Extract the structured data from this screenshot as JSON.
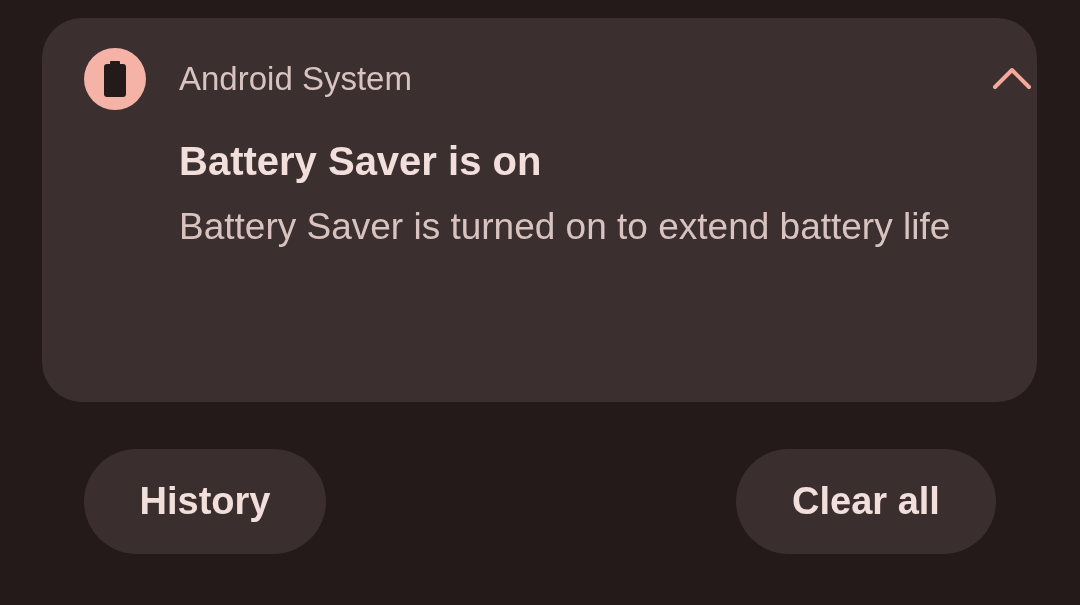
{
  "notification": {
    "app_name": "Android System",
    "title": "Battery Saver is on",
    "text": "Battery Saver is turned on to extend battery life",
    "expanded": true
  },
  "buttons": [
    {
      "label": "History"
    },
    {
      "label": "Clear all"
    }
  ]
}
